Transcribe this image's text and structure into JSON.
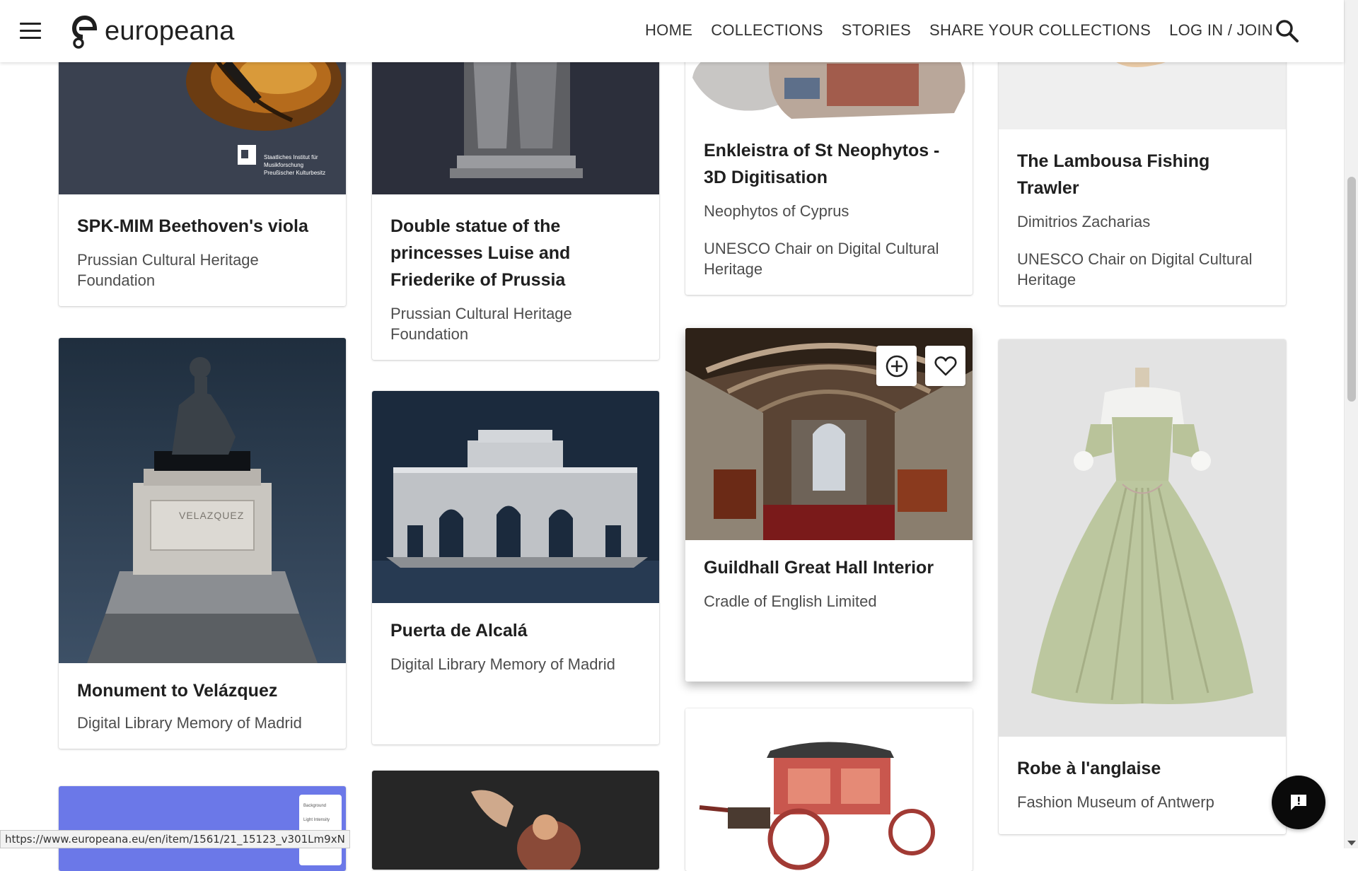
{
  "header": {
    "logo_text": "europeana",
    "nav": [
      "HOME",
      "COLLECTIONS",
      "STORIES",
      "SHARE YOUR COLLECTIONS",
      "LOG IN / JOIN"
    ]
  },
  "cards": {
    "viola": {
      "title": "SPK-MIM Beethoven's viola",
      "provider": "Prussian Cultural Heritage Foundation",
      "image_caption": [
        "Staatliches Institut für",
        "Musikforschung",
        "Preußischer Kulturbesitz"
      ]
    },
    "double_statue": {
      "title": "Double statue of the princesses Luise and Friederike of Prussia",
      "provider": "Prussian Cultural Heritage Foundation"
    },
    "enkleistra": {
      "title": "Enkleistra of St Neophytos - 3D Digitisation",
      "creator": "Neophytos of Cyprus",
      "provider": "UNESCO Chair on Digital Cultural Heritage"
    },
    "lambousa": {
      "title": "The Lambousa Fishing Trawler",
      "creator": "Dimitrios Zacharias",
      "provider": "UNESCO Chair on Digital Cultural Heritage"
    },
    "velazquez": {
      "title": "Monument to Velázquez",
      "provider": "Digital Library Memory of Madrid",
      "plinth_text": "VELAZQUEZ"
    },
    "alcala": {
      "title": "Puerta de Alcalá",
      "provider": "Digital Library Memory of Madrid"
    },
    "guildhall": {
      "title": "Guildhall Great Hall Interior",
      "provider": "Cradle of English Limited"
    },
    "robe": {
      "title": "Robe à l'anglaise",
      "provider": "Fashion Museum of Antwerp"
    },
    "bottom_left": {
      "panel_labels": [
        "Background",
        "Light Intensity",
        "Environment"
      ]
    }
  },
  "status_url": "https://www.europeana.eu/en/item/1561/21_15123_v301Lm9xN",
  "icons": {
    "menu": "hamburger-icon",
    "search": "search-icon",
    "add": "add-circle-icon",
    "like": "heart-icon",
    "feedback": "feedback-chat-icon"
  }
}
